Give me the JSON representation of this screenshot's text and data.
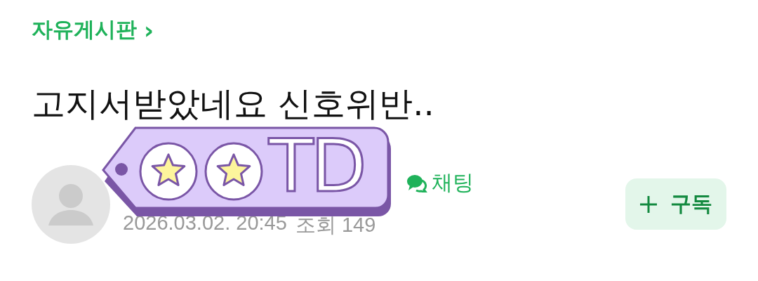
{
  "breadcrumb": {
    "label": "자유게시판",
    "arrow": "›"
  },
  "title": "고지서받았네요 신호위반..",
  "author": {
    "badge_text": "TD",
    "chat_label": "채팅",
    "date": "2026.03.02. 20:45",
    "views_label": "조회",
    "views": "149"
  },
  "subscribe_button": {
    "label": "구독"
  }
}
